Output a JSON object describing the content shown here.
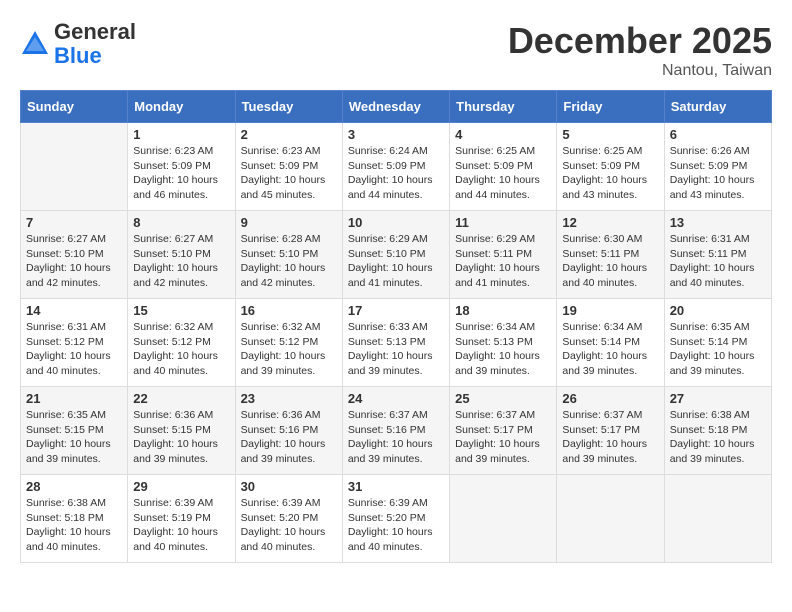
{
  "header": {
    "logo_line1": "General",
    "logo_line2": "Blue",
    "month_title": "December 2025",
    "location": "Nantou, Taiwan"
  },
  "calendar": {
    "days_of_week": [
      "Sunday",
      "Monday",
      "Tuesday",
      "Wednesday",
      "Thursday",
      "Friday",
      "Saturday"
    ],
    "weeks": [
      [
        {
          "day": "",
          "info": ""
        },
        {
          "day": "1",
          "info": "Sunrise: 6:23 AM\nSunset: 5:09 PM\nDaylight: 10 hours\nand 46 minutes."
        },
        {
          "day": "2",
          "info": "Sunrise: 6:23 AM\nSunset: 5:09 PM\nDaylight: 10 hours\nand 45 minutes."
        },
        {
          "day": "3",
          "info": "Sunrise: 6:24 AM\nSunset: 5:09 PM\nDaylight: 10 hours\nand 44 minutes."
        },
        {
          "day": "4",
          "info": "Sunrise: 6:25 AM\nSunset: 5:09 PM\nDaylight: 10 hours\nand 44 minutes."
        },
        {
          "day": "5",
          "info": "Sunrise: 6:25 AM\nSunset: 5:09 PM\nDaylight: 10 hours\nand 43 minutes."
        },
        {
          "day": "6",
          "info": "Sunrise: 6:26 AM\nSunset: 5:09 PM\nDaylight: 10 hours\nand 43 minutes."
        }
      ],
      [
        {
          "day": "7",
          "info": "Sunrise: 6:27 AM\nSunset: 5:10 PM\nDaylight: 10 hours\nand 42 minutes."
        },
        {
          "day": "8",
          "info": "Sunrise: 6:27 AM\nSunset: 5:10 PM\nDaylight: 10 hours\nand 42 minutes."
        },
        {
          "day": "9",
          "info": "Sunrise: 6:28 AM\nSunset: 5:10 PM\nDaylight: 10 hours\nand 42 minutes."
        },
        {
          "day": "10",
          "info": "Sunrise: 6:29 AM\nSunset: 5:10 PM\nDaylight: 10 hours\nand 41 minutes."
        },
        {
          "day": "11",
          "info": "Sunrise: 6:29 AM\nSunset: 5:11 PM\nDaylight: 10 hours\nand 41 minutes."
        },
        {
          "day": "12",
          "info": "Sunrise: 6:30 AM\nSunset: 5:11 PM\nDaylight: 10 hours\nand 40 minutes."
        },
        {
          "day": "13",
          "info": "Sunrise: 6:31 AM\nSunset: 5:11 PM\nDaylight: 10 hours\nand 40 minutes."
        }
      ],
      [
        {
          "day": "14",
          "info": "Sunrise: 6:31 AM\nSunset: 5:12 PM\nDaylight: 10 hours\nand 40 minutes."
        },
        {
          "day": "15",
          "info": "Sunrise: 6:32 AM\nSunset: 5:12 PM\nDaylight: 10 hours\nand 40 minutes."
        },
        {
          "day": "16",
          "info": "Sunrise: 6:32 AM\nSunset: 5:12 PM\nDaylight: 10 hours\nand 39 minutes."
        },
        {
          "day": "17",
          "info": "Sunrise: 6:33 AM\nSunset: 5:13 PM\nDaylight: 10 hours\nand 39 minutes."
        },
        {
          "day": "18",
          "info": "Sunrise: 6:34 AM\nSunset: 5:13 PM\nDaylight: 10 hours\nand 39 minutes."
        },
        {
          "day": "19",
          "info": "Sunrise: 6:34 AM\nSunset: 5:14 PM\nDaylight: 10 hours\nand 39 minutes."
        },
        {
          "day": "20",
          "info": "Sunrise: 6:35 AM\nSunset: 5:14 PM\nDaylight: 10 hours\nand 39 minutes."
        }
      ],
      [
        {
          "day": "21",
          "info": "Sunrise: 6:35 AM\nSunset: 5:15 PM\nDaylight: 10 hours\nand 39 minutes."
        },
        {
          "day": "22",
          "info": "Sunrise: 6:36 AM\nSunset: 5:15 PM\nDaylight: 10 hours\nand 39 minutes."
        },
        {
          "day": "23",
          "info": "Sunrise: 6:36 AM\nSunset: 5:16 PM\nDaylight: 10 hours\nand 39 minutes."
        },
        {
          "day": "24",
          "info": "Sunrise: 6:37 AM\nSunset: 5:16 PM\nDaylight: 10 hours\nand 39 minutes."
        },
        {
          "day": "25",
          "info": "Sunrise: 6:37 AM\nSunset: 5:17 PM\nDaylight: 10 hours\nand 39 minutes."
        },
        {
          "day": "26",
          "info": "Sunrise: 6:37 AM\nSunset: 5:17 PM\nDaylight: 10 hours\nand 39 minutes."
        },
        {
          "day": "27",
          "info": "Sunrise: 6:38 AM\nSunset: 5:18 PM\nDaylight: 10 hours\nand 39 minutes."
        }
      ],
      [
        {
          "day": "28",
          "info": "Sunrise: 6:38 AM\nSunset: 5:18 PM\nDaylight: 10 hours\nand 40 minutes."
        },
        {
          "day": "29",
          "info": "Sunrise: 6:39 AM\nSunset: 5:19 PM\nDaylight: 10 hours\nand 40 minutes."
        },
        {
          "day": "30",
          "info": "Sunrise: 6:39 AM\nSunset: 5:20 PM\nDaylight: 10 hours\nand 40 minutes."
        },
        {
          "day": "31",
          "info": "Sunrise: 6:39 AM\nSunset: 5:20 PM\nDaylight: 10 hours\nand 40 minutes."
        },
        {
          "day": "",
          "info": ""
        },
        {
          "day": "",
          "info": ""
        },
        {
          "day": "",
          "info": ""
        }
      ]
    ]
  }
}
